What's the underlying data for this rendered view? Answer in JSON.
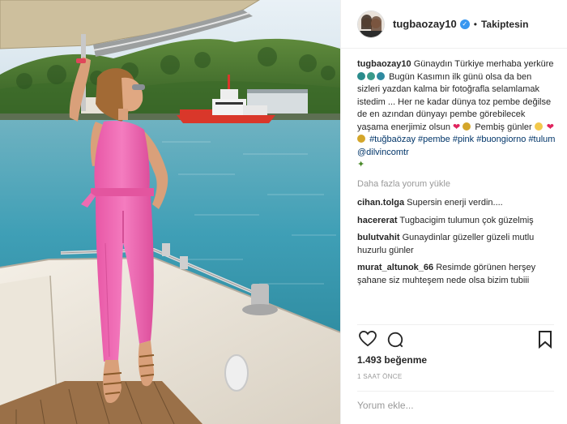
{
  "post": {
    "username": "tugbaozay10",
    "verified": true,
    "follow_status": "Takiptesin",
    "separator": "•"
  },
  "caption": {
    "username": "tugbaozay10",
    "line1": "Günaydın Türkiye merhaba",
    "line2a": "yerküre",
    "line2b": "Bugün Kasımın ilk günü",
    "line3": "olsa da ben sizleri yazdan kalma bir",
    "line4": "fotoğrafla selamlamak istedim ... Her ne",
    "line5": "kadar dünya toz pembe değilse de en",
    "line6": "azından dünyayı pembe görebilecek",
    "line7": "yaşama enerjimiz olsun",
    "line8a": "Pembiş",
    "line8b": "günler",
    "hashtag1": "#tuğbaözay",
    "hashtag2": "#pembe",
    "hashtag3": "#pink",
    "hashtag4": "#buongiorno",
    "hashtag5": "#tulum",
    "mention": "@dilvincomtr"
  },
  "load_more": "Daha fazla yorum yükle",
  "comments": [
    {
      "user": "cihan.tolga",
      "text": "Supersin enerji verdin...."
    },
    {
      "user": "hacererat",
      "text": "Tugbacigim tulumun çok güzelmiş"
    },
    {
      "user": "bulutvahit",
      "text": "Gunaydinlar güzeller güzeli mutlu huzurlu günler"
    },
    {
      "user": "murat_altunok_66",
      "text": "Resimde görünen herşey şahane siz muhteşem nede olsa bizim tubiii"
    }
  ],
  "likes": "1.493 beğenme",
  "timestamp": "1 SAAT ÖNCE",
  "add_comment_placeholder": "Yorum ekle...",
  "icons": {
    "like": "heart-icon",
    "comment": "comment-icon",
    "save": "bookmark-icon",
    "verified": "verified-badge-icon"
  },
  "colors": {
    "hashtag": "#003569",
    "muted": "#999999",
    "verified": "#3897f0",
    "jumpsuit": "#f06fb5",
    "sea": "#3f9fb6"
  }
}
